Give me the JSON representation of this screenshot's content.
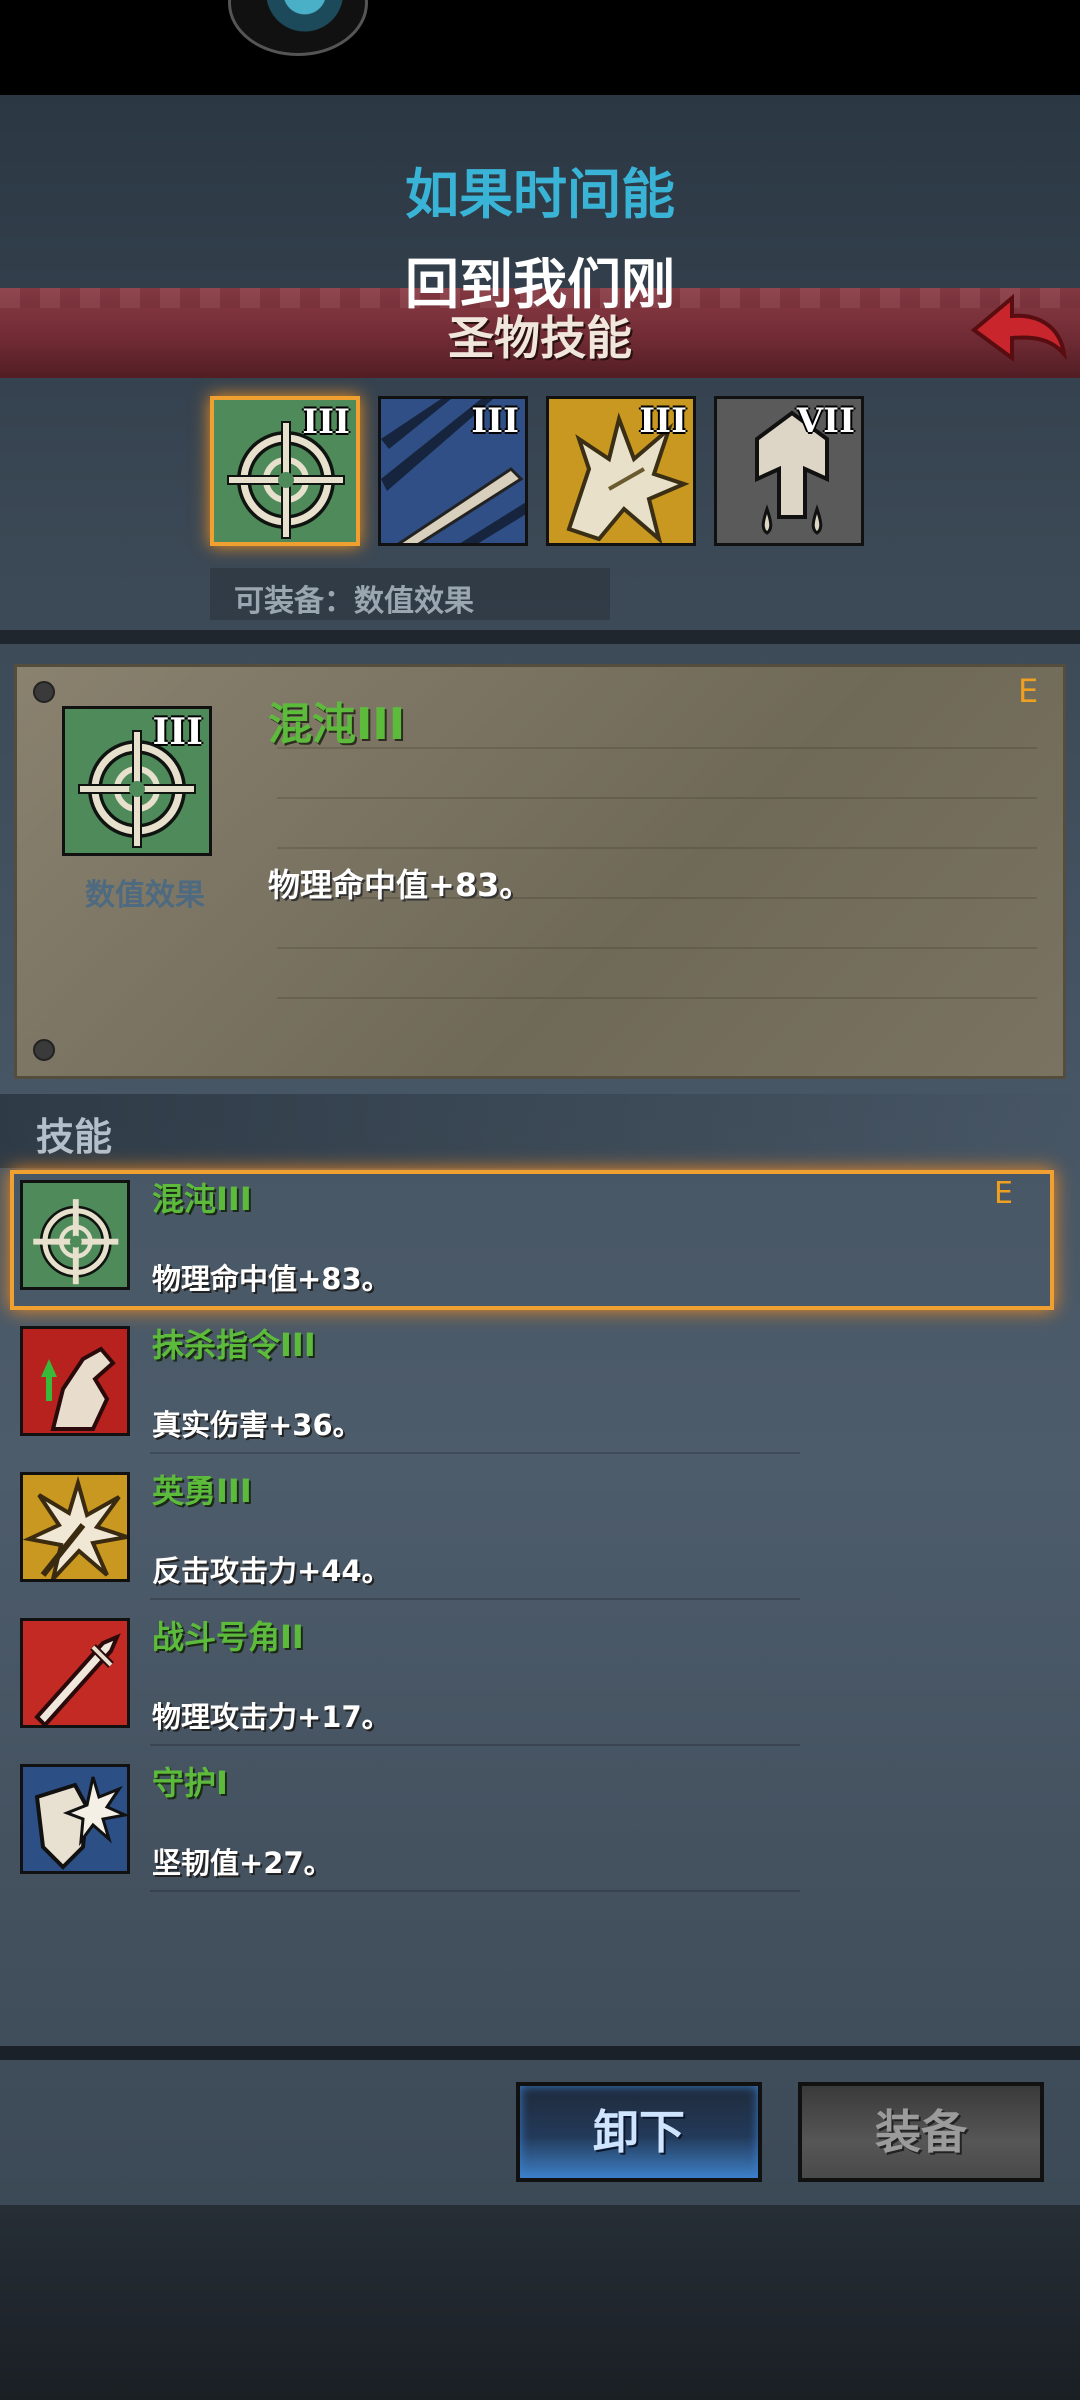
{
  "subtitles": {
    "line1": "如果时间能",
    "line2": "回到我们刚"
  },
  "header": {
    "title": "圣物技能",
    "back_icon": "back-arrow-icon"
  },
  "tabs": [
    {
      "icon": "crosshair-icon",
      "roman": "III",
      "bg": "#4f8a5a",
      "selected": true
    },
    {
      "icon": "claw-slash-icon",
      "roman": "III",
      "bg": "#2f4f86",
      "selected": false
    },
    {
      "icon": "beast-claw-icon",
      "roman": "III",
      "bg": "#c99820",
      "selected": false
    },
    {
      "icon": "axe-drop-icon",
      "roman": "VII",
      "bg": "#5a5a5a",
      "selected": false
    }
  ],
  "equip_hint": "可装备：数值效果",
  "detail": {
    "name": "混沌III",
    "type": "数值效果",
    "badge": "E",
    "roman": "III",
    "desc": "物理命中值+83。"
  },
  "skills_header": "技能",
  "skills": [
    {
      "icon": "crosshair-icon",
      "name": "混沌III",
      "desc": "物理命中值+83。",
      "badge": "E"
    },
    {
      "icon": "arm-up-icon",
      "name": "抹杀指令III",
      "desc": "真实伤害+36。",
      "badge": ""
    },
    {
      "icon": "burst-icon",
      "name": "英勇III",
      "desc": "反击攻击力+44。",
      "badge": ""
    },
    {
      "icon": "sword-icon",
      "name": "战斗号角II",
      "desc": "物理攻击力+17。",
      "badge": ""
    },
    {
      "icon": "shield-burst-icon",
      "name": "守护I",
      "desc": "坚韧值+27。",
      "badge": ""
    }
  ],
  "buttons": {
    "unequip": "卸下",
    "equip": "装备"
  },
  "colors": {
    "accent_orange": "#f0a030",
    "name_green": "#5dbb3c",
    "subtitle_blue": "#3ab4d6",
    "banner_red": "#7a3038"
  }
}
